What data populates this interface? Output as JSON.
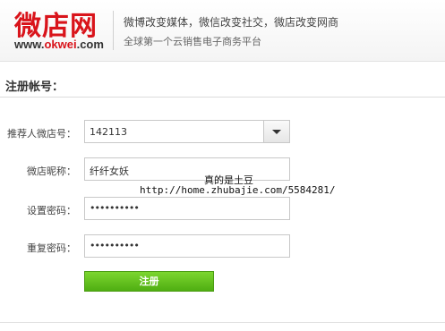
{
  "header": {
    "logo_cn": "微店网",
    "logo_en_prefix": "www.",
    "logo_en_accent": "okwei",
    "logo_en_suffix": ".com",
    "slogan": "微博改变媒体，微信改变社交，微店改变网商",
    "subslogan": "全球第一个云销售电子商务平台"
  },
  "form": {
    "section_title": "注册帐号：",
    "referrer_label": "推荐人微店号：",
    "referrer_value": "142113",
    "nickname_label": "微店昵称：",
    "nickname_value": "纤纤女妖",
    "password_label": "设置密码：",
    "password_mask": "••••••••••",
    "confirm_label": "重复密码：",
    "confirm_mask": "••••••••••",
    "submit_label": "注册"
  },
  "watermark": {
    "line1": "真的是土豆",
    "line2": "http://home.zhubajie.com/5584281/"
  }
}
